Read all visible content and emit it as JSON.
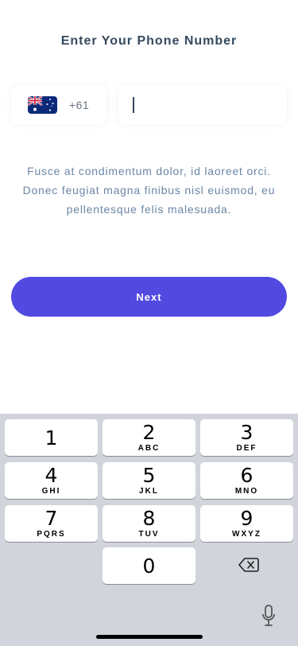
{
  "header": {
    "title": "Enter Your Phone Number"
  },
  "phone": {
    "country_flag": "australia-flag-icon",
    "dial_code": "+61",
    "value": ""
  },
  "description": {
    "line1": "Fusce at condimentum dolor, id laoreet orci.",
    "line2": "Donec feugiat magna finibus nisl euismod, eu",
    "line3": "pellentesque felis malesuada."
  },
  "actions": {
    "next_label": "Next"
  },
  "keyboard": {
    "keys": [
      {
        "num": "1",
        "letters": ""
      },
      {
        "num": "2",
        "letters": "ABC"
      },
      {
        "num": "3",
        "letters": "DEF"
      },
      {
        "num": "4",
        "letters": "GHI"
      },
      {
        "num": "5",
        "letters": "JKL"
      },
      {
        "num": "6",
        "letters": "MNO"
      },
      {
        "num": "7",
        "letters": "PQRS"
      },
      {
        "num": "8",
        "letters": "TUV"
      },
      {
        "num": "9",
        "letters": "WXYZ"
      },
      {
        "num": "0",
        "letters": ""
      }
    ],
    "delete_icon": "backspace-icon",
    "mic_icon": "microphone-icon"
  },
  "colors": {
    "accent": "#5149e0",
    "title": "#34495e",
    "description": "#6b86a6",
    "keyboard_bg": "#d1d4db"
  }
}
